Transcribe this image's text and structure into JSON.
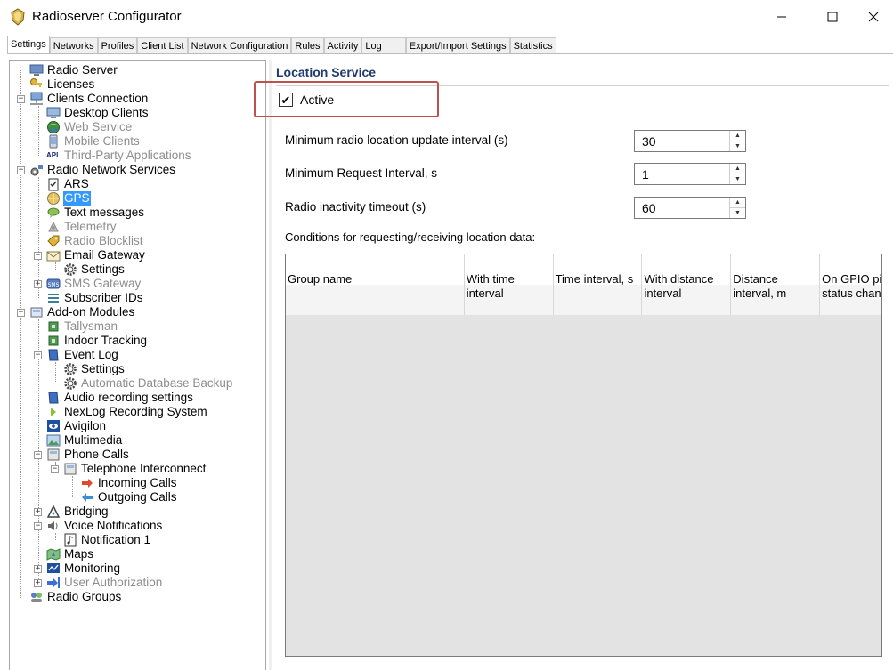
{
  "window": {
    "title": "Radioserver Configurator",
    "min": "—",
    "max": "☐",
    "close": "✕"
  },
  "tabs": [
    "Settings",
    "Networks",
    "Profiles",
    "Client List",
    "Network Configuration",
    "Rules",
    "Activity",
    "Log",
    "Export/Import Settings",
    "Statistics"
  ],
  "tree": {
    "radio_server": "Radio Server",
    "licenses": "Licenses",
    "clients_connection": "Clients Connection",
    "desktop_clients": "Desktop Clients",
    "web_service": "Web Service",
    "mobile_clients": "Mobile Clients",
    "third_party": "Third-Party Applications",
    "api_tag": "API",
    "radio_network_services": "Radio Network Services",
    "ars": "ARS",
    "gps": "GPS",
    "text_messages": "Text messages",
    "telemetry": "Telemetry",
    "radio_blocklist": "Radio Blocklist",
    "email_gateway": "Email Gateway",
    "settings": "Settings",
    "sms_gateway": "SMS Gateway",
    "subscriber_ids": "Subscriber IDs",
    "addon_modules": "Add-on Modules",
    "tallysman": "Tallysman",
    "indoor_tracking": "Indoor Tracking",
    "event_log": "Event Log",
    "event_log_settings": "Settings",
    "auto_db_backup": "Automatic Database Backup",
    "audio_recording": "Audio recording settings",
    "nexlog": "NexLog Recording System",
    "avigilon": "Avigilon",
    "multimedia": "Multimedia",
    "phone_calls": "Phone Calls",
    "telephone_interconnect": "Telephone Interconnect",
    "incoming_calls": "Incoming Calls",
    "outgoing_calls": "Outgoing Calls",
    "bridging": "Bridging",
    "voice_notifications": "Voice Notifications",
    "notification_1": "Notification 1",
    "maps": "Maps",
    "monitoring": "Monitoring",
    "user_authorization": "User Authorization",
    "radio_groups": "Radio Groups"
  },
  "location": {
    "title": "Location Service",
    "active_label": "Active",
    "active_checked": true,
    "check_glyph": "✔",
    "fields": [
      {
        "label": "Minimum radio location update interval (s)",
        "value": "30"
      },
      {
        "label": "Minimum Request Interval, s",
        "value": "1"
      },
      {
        "label": "Radio inactivity timeout (s)",
        "value": "60"
      }
    ],
    "conditions_label": "Conditions for requesting/receiving location data:",
    "columns": [
      "Group name",
      "With time\ninterval",
      "Time interval, s",
      "With distance\ninterval",
      "Distance\ninterval, m",
      "On GPIO pin\nstatus change"
    ]
  },
  "colors": {
    "selection": "#3399ff",
    "highlight_box": "#c0504d",
    "section_title": "#1e3a6e"
  }
}
